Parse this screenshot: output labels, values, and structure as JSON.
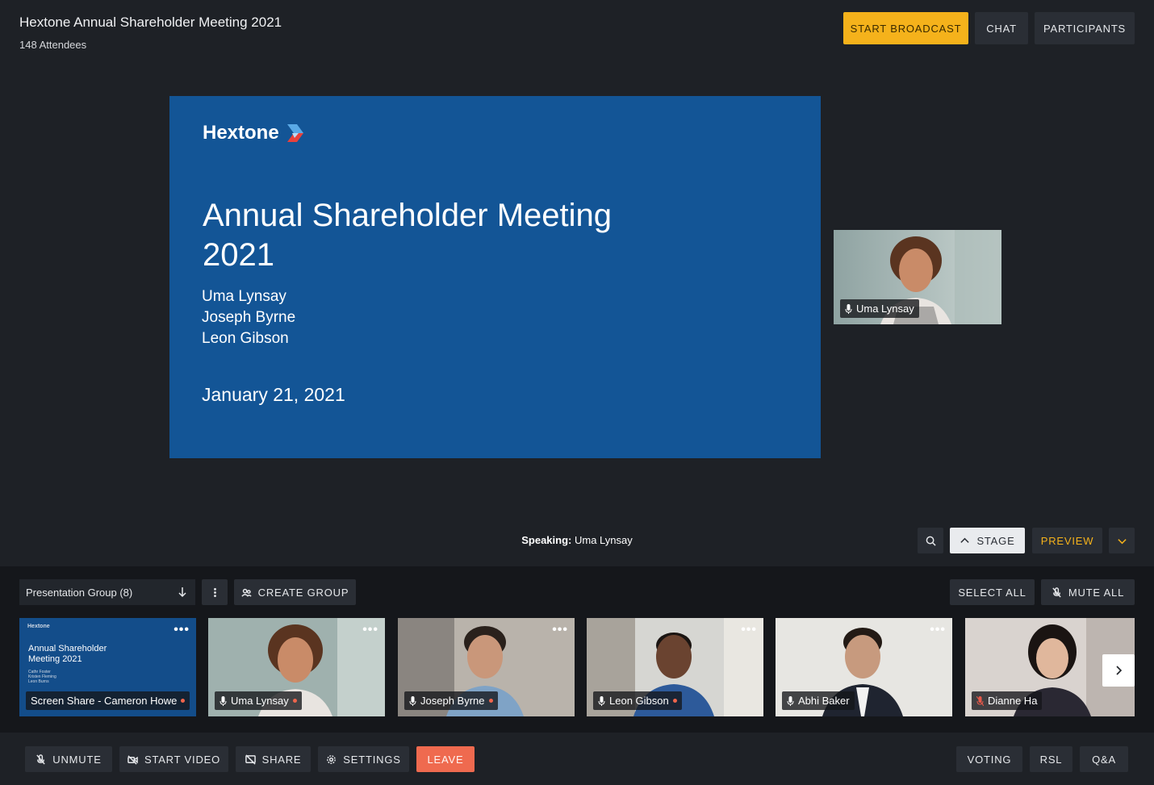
{
  "header": {
    "title": "Hextone Annual Shareholder Meeting 2021",
    "attendees": "148 Attendees",
    "broadcast_label": "START BROADCAST",
    "chat_label": "CHAT",
    "participants_label": "PARTICIPANTS"
  },
  "slide": {
    "logo_text": "Hextone",
    "title": "Annual Shareholder Meeting 2021",
    "names": [
      "Uma Lynsay",
      "Joseph Byrne",
      "Leon Gibson"
    ],
    "date": "January 21, 2021"
  },
  "speaker_video": {
    "name": "Uma Lynsay"
  },
  "speaking": {
    "label": "Speaking:",
    "name": "Uma Lynsay"
  },
  "view_controls": {
    "stage_label": "STAGE",
    "preview_label": "PREVIEW"
  },
  "gallery": {
    "group_select": "Presentation Group (8)",
    "create_group_label": "CREATE GROUP",
    "select_all_label": "SELECT ALL",
    "mute_all_label": "MUTE ALL",
    "screen_share_tile": {
      "mini_logo": "Hextone",
      "mini_title": "Annual Shareholder Meeting 2021",
      "mini_names": [
        "Cathr Foster",
        "Kristen Fleming",
        "Leon Burns"
      ],
      "label": "Screen Share - Cameron Howe"
    },
    "tiles": [
      {
        "name": "Uma Lynsay",
        "muted": false,
        "recording": true
      },
      {
        "name": "Joseph Byrne",
        "muted": false,
        "recording": true
      },
      {
        "name": "Leon Gibson",
        "muted": false,
        "recording": true
      },
      {
        "name": "Abhi Baker",
        "muted": false,
        "recording": false
      },
      {
        "name": "Dianne Ha",
        "muted": true,
        "recording": false
      }
    ]
  },
  "toolbar": {
    "unmute_label": "UNMUTE",
    "video_label": "START VIDEO",
    "share_label": "SHARE",
    "settings_label": "SETTINGS",
    "leave_label": "LEAVE",
    "voting_label": "VOTING",
    "rsl_label": "RSL",
    "qa_label": "Q&A"
  },
  "colors": {
    "accent": "#f5b21b",
    "leave": "#ef6a4f",
    "slide_blue": "#135596",
    "recording_dot": "#f0654c"
  }
}
